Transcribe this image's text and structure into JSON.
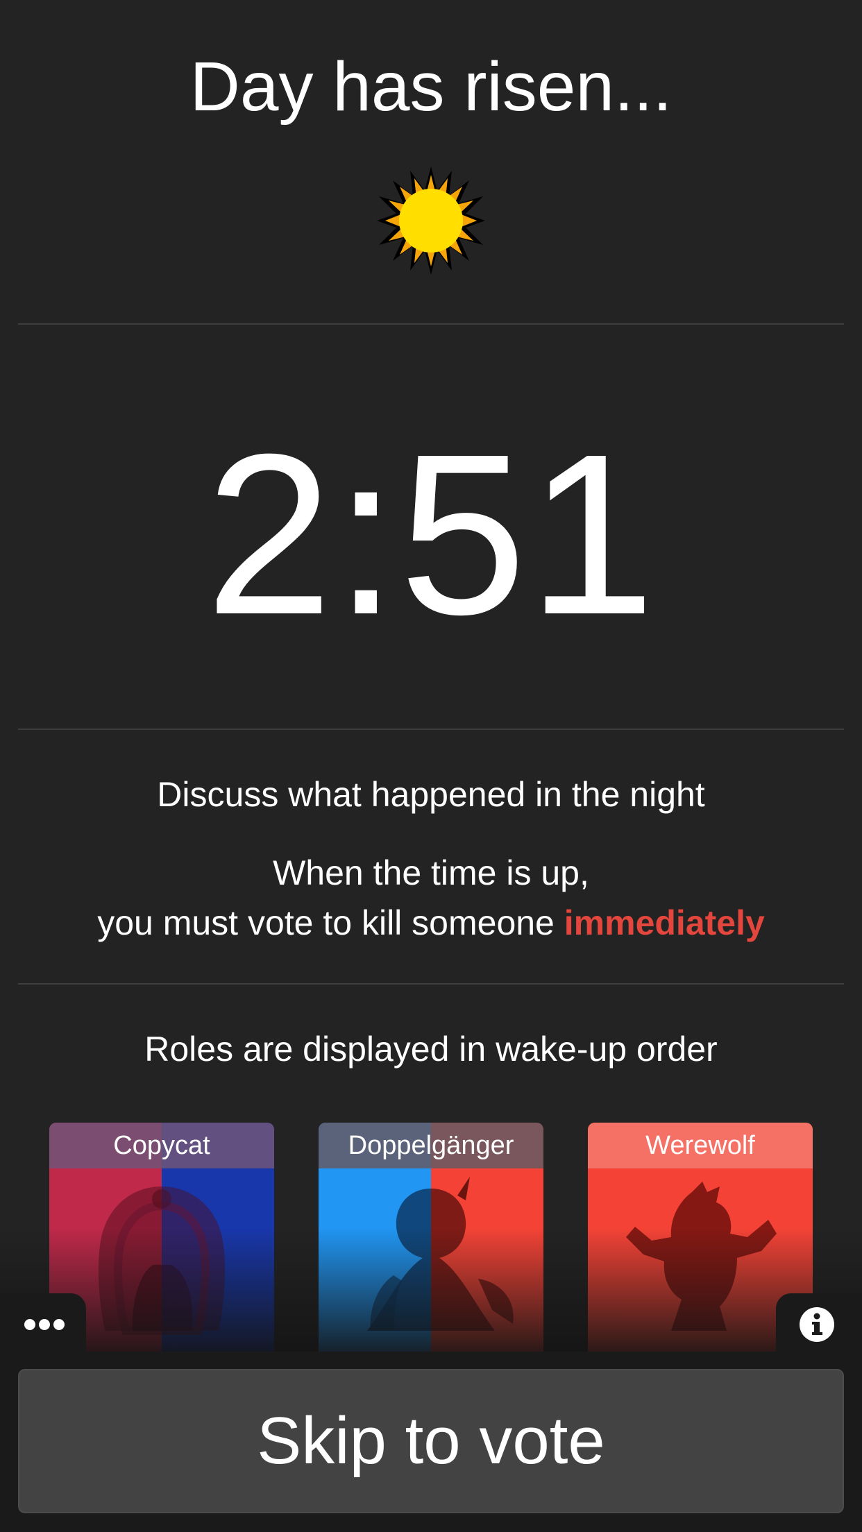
{
  "header": {
    "title": "Day has risen..."
  },
  "timer": {
    "value": "2:51"
  },
  "instructions": {
    "line1": "Discuss what happened in the night",
    "line2": "When the time is up,",
    "line3_prefix": "you must vote to kill someone ",
    "line3_emphasis": "immediately"
  },
  "roles": {
    "caption": "Roles are displayed in wake-up order",
    "cards": [
      {
        "name": "Copycat",
        "icon": "copycat-icon"
      },
      {
        "name": "Doppelgänger",
        "icon": "doppelganger-icon"
      },
      {
        "name": "Werewolf",
        "icon": "werewolf-icon"
      }
    ]
  },
  "footer": {
    "skip_label": "Skip to vote"
  },
  "colors": {
    "background": "#232323",
    "emphasis": "#e2463c",
    "button": "#434343"
  }
}
